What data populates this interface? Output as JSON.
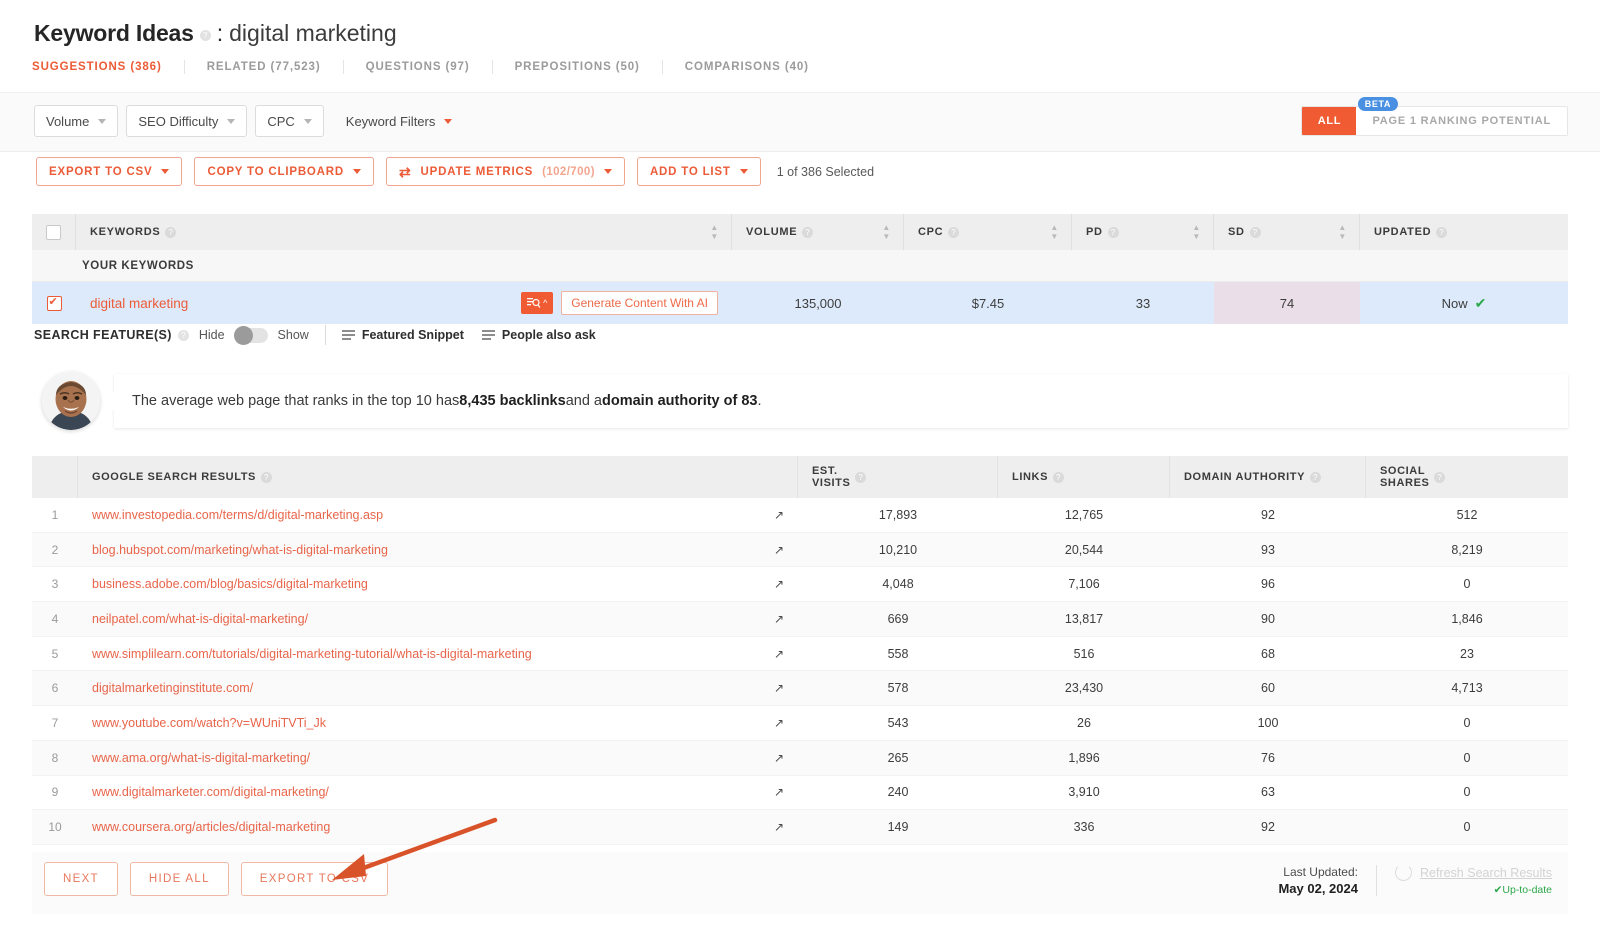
{
  "header": {
    "title": "Keyword Ideas",
    "separator": ":",
    "keyword": "digital marketing",
    "info_icon": "?"
  },
  "tabs": [
    {
      "label": "SUGGESTIONS (386)",
      "active": true
    },
    {
      "label": "RELATED (77,523)",
      "active": false
    },
    {
      "label": "QUESTIONS (97)",
      "active": false
    },
    {
      "label": "PREPOSITIONS (50)",
      "active": false
    },
    {
      "label": "COMPARISONS (40)",
      "active": false
    }
  ],
  "filters": [
    {
      "label": "Volume",
      "boxed": true
    },
    {
      "label": "SEO Difficulty",
      "boxed": true
    },
    {
      "label": "CPC",
      "boxed": true
    },
    {
      "label": "Keyword Filters",
      "boxed": false
    }
  ],
  "segmented": {
    "beta_badge": "BETA",
    "all_label": "ALL",
    "page1_label": "PAGE 1 RANKING POTENTIAL"
  },
  "actions": {
    "export_csv": "EXPORT TO CSV",
    "copy_clipboard": "COPY TO CLIPBOARD",
    "update_metrics": "UPDATE METRICS",
    "update_metrics_count": "(102/700)",
    "add_to_list": "ADD TO LIST",
    "selected_text": "1 of 386 Selected"
  },
  "keyword_table": {
    "columns": [
      "KEYWORDS",
      "VOLUME",
      "CPC",
      "PD",
      "SD",
      "UPDATED"
    ],
    "group_label": "YOUR KEYWORDS",
    "row": {
      "keyword": "digital marketing",
      "ai_button": "Generate Content With AI",
      "volume": "135,000",
      "cpc": "$7.45",
      "pd": "33",
      "sd": "74",
      "updated": "Now"
    }
  },
  "search_features": {
    "label": "SEARCH FEATURE(S)",
    "hide_label": "Hide",
    "show_label": "Show",
    "chips": [
      "Featured Snippet",
      "People also ask"
    ]
  },
  "insight": {
    "text_part1": "The average web page that ranks in the top 10 has ",
    "bold1": "8,435 backlinks",
    "text_part2": " and a ",
    "bold2": "domain authority of 83",
    "text_part3": "."
  },
  "serp_table": {
    "columns": [
      "GOOGLE SEARCH RESULTS",
      "EST. VISITS",
      "LINKS",
      "DOMAIN AUTHORITY",
      "SOCIAL SHARES"
    ],
    "col_visits_l1": "EST.",
    "col_visits_l2": "VISITS",
    "col_social_l1": "SOCIAL",
    "col_social_l2": "SHARES",
    "rows": [
      {
        "rank": "1",
        "url": "www.investopedia.com/terms/d/digital-marketing.asp",
        "visits": "17,893",
        "links": "12,765",
        "da": "92",
        "social": "512"
      },
      {
        "rank": "2",
        "url": "blog.hubspot.com/marketing/what-is-digital-marketing",
        "visits": "10,210",
        "links": "20,544",
        "da": "93",
        "social": "8,219"
      },
      {
        "rank": "3",
        "url": "business.adobe.com/blog/basics/digital-marketing",
        "visits": "4,048",
        "links": "7,106",
        "da": "96",
        "social": "0"
      },
      {
        "rank": "4",
        "url": "neilpatel.com/what-is-digital-marketing/",
        "visits": "669",
        "links": "13,817",
        "da": "90",
        "social": "1,846"
      },
      {
        "rank": "5",
        "url": "www.simplilearn.com/tutorials/digital-marketing-tutorial/what-is-digital-marketing",
        "visits": "558",
        "links": "516",
        "da": "68",
        "social": "23"
      },
      {
        "rank": "6",
        "url": "digitalmarketinginstitute.com/",
        "visits": "578",
        "links": "23,430",
        "da": "60",
        "social": "4,713"
      },
      {
        "rank": "7",
        "url": "www.youtube.com/watch?v=WUniTVTi_Jk",
        "visits": "543",
        "links": "26",
        "da": "100",
        "social": "0"
      },
      {
        "rank": "8",
        "url": "www.ama.org/what-is-digital-marketing/",
        "visits": "265",
        "links": "1,896",
        "da": "76",
        "social": "0"
      },
      {
        "rank": "9",
        "url": "www.digitalmarketer.com/digital-marketing/",
        "visits": "240",
        "links": "3,910",
        "da": "63",
        "social": "0"
      },
      {
        "rank": "10",
        "url": "www.coursera.org/articles/digital-marketing",
        "visits": "149",
        "links": "336",
        "da": "92",
        "social": "0"
      }
    ]
  },
  "footer": {
    "next": "NEXT",
    "hide_all": "HIDE ALL",
    "export_csv": "EXPORT TO CSV",
    "last_updated_label": "Last Updated:",
    "last_updated_value": "May 02, 2024",
    "refresh_label": "Refresh Search Results",
    "uptodate_label": "Up-to-date"
  },
  "colors": {
    "accent": "#ec5b37",
    "accent_solid": "#f05b33",
    "beta_blue": "#4a90e2",
    "row_highlight": "#ddeafc",
    "sd_cell": "#eadfe8",
    "success_green": "#2aa84a",
    "arrow": "#d9532a"
  }
}
